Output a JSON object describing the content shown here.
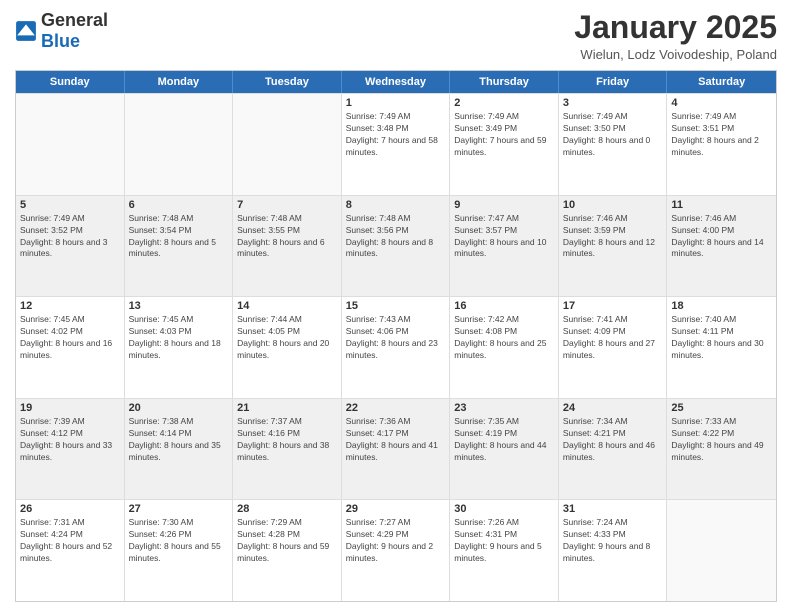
{
  "logo": {
    "general": "General",
    "blue": "Blue"
  },
  "header": {
    "month": "January 2025",
    "location": "Wielun, Lodz Voivodeship, Poland"
  },
  "weekdays": [
    "Sunday",
    "Monday",
    "Tuesday",
    "Wednesday",
    "Thursday",
    "Friday",
    "Saturday"
  ],
  "weeks": [
    [
      {
        "day": "",
        "sunrise": "",
        "sunset": "",
        "daylight": ""
      },
      {
        "day": "",
        "sunrise": "",
        "sunset": "",
        "daylight": ""
      },
      {
        "day": "",
        "sunrise": "",
        "sunset": "",
        "daylight": ""
      },
      {
        "day": "1",
        "sunrise": "Sunrise: 7:49 AM",
        "sunset": "Sunset: 3:48 PM",
        "daylight": "Daylight: 7 hours and 58 minutes."
      },
      {
        "day": "2",
        "sunrise": "Sunrise: 7:49 AM",
        "sunset": "Sunset: 3:49 PM",
        "daylight": "Daylight: 7 hours and 59 minutes."
      },
      {
        "day": "3",
        "sunrise": "Sunrise: 7:49 AM",
        "sunset": "Sunset: 3:50 PM",
        "daylight": "Daylight: 8 hours and 0 minutes."
      },
      {
        "day": "4",
        "sunrise": "Sunrise: 7:49 AM",
        "sunset": "Sunset: 3:51 PM",
        "daylight": "Daylight: 8 hours and 2 minutes."
      }
    ],
    [
      {
        "day": "5",
        "sunrise": "Sunrise: 7:49 AM",
        "sunset": "Sunset: 3:52 PM",
        "daylight": "Daylight: 8 hours and 3 minutes."
      },
      {
        "day": "6",
        "sunrise": "Sunrise: 7:48 AM",
        "sunset": "Sunset: 3:54 PM",
        "daylight": "Daylight: 8 hours and 5 minutes."
      },
      {
        "day": "7",
        "sunrise": "Sunrise: 7:48 AM",
        "sunset": "Sunset: 3:55 PM",
        "daylight": "Daylight: 8 hours and 6 minutes."
      },
      {
        "day": "8",
        "sunrise": "Sunrise: 7:48 AM",
        "sunset": "Sunset: 3:56 PM",
        "daylight": "Daylight: 8 hours and 8 minutes."
      },
      {
        "day": "9",
        "sunrise": "Sunrise: 7:47 AM",
        "sunset": "Sunset: 3:57 PM",
        "daylight": "Daylight: 8 hours and 10 minutes."
      },
      {
        "day": "10",
        "sunrise": "Sunrise: 7:46 AM",
        "sunset": "Sunset: 3:59 PM",
        "daylight": "Daylight: 8 hours and 12 minutes."
      },
      {
        "day": "11",
        "sunrise": "Sunrise: 7:46 AM",
        "sunset": "Sunset: 4:00 PM",
        "daylight": "Daylight: 8 hours and 14 minutes."
      }
    ],
    [
      {
        "day": "12",
        "sunrise": "Sunrise: 7:45 AM",
        "sunset": "Sunset: 4:02 PM",
        "daylight": "Daylight: 8 hours and 16 minutes."
      },
      {
        "day": "13",
        "sunrise": "Sunrise: 7:45 AM",
        "sunset": "Sunset: 4:03 PM",
        "daylight": "Daylight: 8 hours and 18 minutes."
      },
      {
        "day": "14",
        "sunrise": "Sunrise: 7:44 AM",
        "sunset": "Sunset: 4:05 PM",
        "daylight": "Daylight: 8 hours and 20 minutes."
      },
      {
        "day": "15",
        "sunrise": "Sunrise: 7:43 AM",
        "sunset": "Sunset: 4:06 PM",
        "daylight": "Daylight: 8 hours and 23 minutes."
      },
      {
        "day": "16",
        "sunrise": "Sunrise: 7:42 AM",
        "sunset": "Sunset: 4:08 PM",
        "daylight": "Daylight: 8 hours and 25 minutes."
      },
      {
        "day": "17",
        "sunrise": "Sunrise: 7:41 AM",
        "sunset": "Sunset: 4:09 PM",
        "daylight": "Daylight: 8 hours and 27 minutes."
      },
      {
        "day": "18",
        "sunrise": "Sunrise: 7:40 AM",
        "sunset": "Sunset: 4:11 PM",
        "daylight": "Daylight: 8 hours and 30 minutes."
      }
    ],
    [
      {
        "day": "19",
        "sunrise": "Sunrise: 7:39 AM",
        "sunset": "Sunset: 4:12 PM",
        "daylight": "Daylight: 8 hours and 33 minutes."
      },
      {
        "day": "20",
        "sunrise": "Sunrise: 7:38 AM",
        "sunset": "Sunset: 4:14 PM",
        "daylight": "Daylight: 8 hours and 35 minutes."
      },
      {
        "day": "21",
        "sunrise": "Sunrise: 7:37 AM",
        "sunset": "Sunset: 4:16 PM",
        "daylight": "Daylight: 8 hours and 38 minutes."
      },
      {
        "day": "22",
        "sunrise": "Sunrise: 7:36 AM",
        "sunset": "Sunset: 4:17 PM",
        "daylight": "Daylight: 8 hours and 41 minutes."
      },
      {
        "day": "23",
        "sunrise": "Sunrise: 7:35 AM",
        "sunset": "Sunset: 4:19 PM",
        "daylight": "Daylight: 8 hours and 44 minutes."
      },
      {
        "day": "24",
        "sunrise": "Sunrise: 7:34 AM",
        "sunset": "Sunset: 4:21 PM",
        "daylight": "Daylight: 8 hours and 46 minutes."
      },
      {
        "day": "25",
        "sunrise": "Sunrise: 7:33 AM",
        "sunset": "Sunset: 4:22 PM",
        "daylight": "Daylight: 8 hours and 49 minutes."
      }
    ],
    [
      {
        "day": "26",
        "sunrise": "Sunrise: 7:31 AM",
        "sunset": "Sunset: 4:24 PM",
        "daylight": "Daylight: 8 hours and 52 minutes."
      },
      {
        "day": "27",
        "sunrise": "Sunrise: 7:30 AM",
        "sunset": "Sunset: 4:26 PM",
        "daylight": "Daylight: 8 hours and 55 minutes."
      },
      {
        "day": "28",
        "sunrise": "Sunrise: 7:29 AM",
        "sunset": "Sunset: 4:28 PM",
        "daylight": "Daylight: 8 hours and 59 minutes."
      },
      {
        "day": "29",
        "sunrise": "Sunrise: 7:27 AM",
        "sunset": "Sunset: 4:29 PM",
        "daylight": "Daylight: 9 hours and 2 minutes."
      },
      {
        "day": "30",
        "sunrise": "Sunrise: 7:26 AM",
        "sunset": "Sunset: 4:31 PM",
        "daylight": "Daylight: 9 hours and 5 minutes."
      },
      {
        "day": "31",
        "sunrise": "Sunrise: 7:24 AM",
        "sunset": "Sunset: 4:33 PM",
        "daylight": "Daylight: 9 hours and 8 minutes."
      },
      {
        "day": "",
        "sunrise": "",
        "sunset": "",
        "daylight": ""
      }
    ]
  ]
}
